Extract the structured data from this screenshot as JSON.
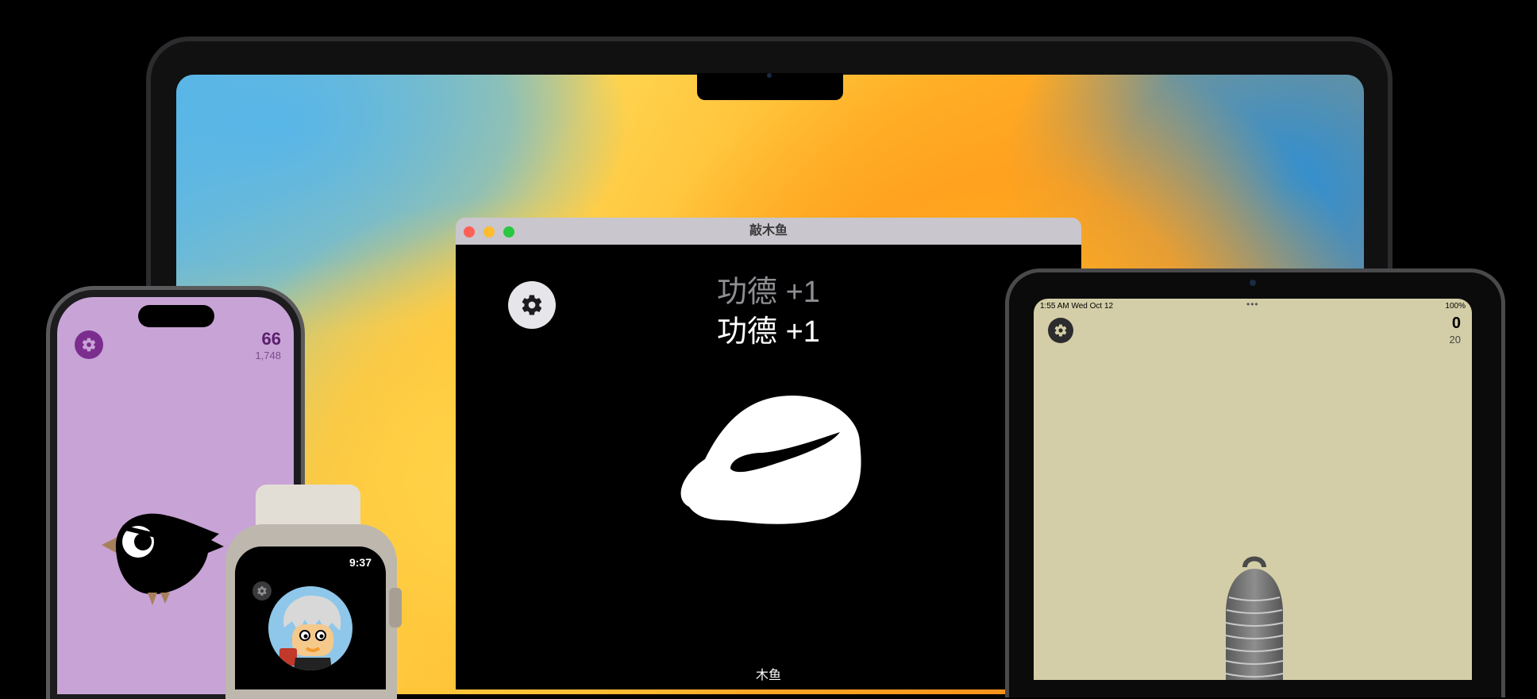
{
  "mac_window": {
    "title": "敲木鱼",
    "merit_faded": "功德 +1",
    "merit_main": "功德 +1",
    "bottom_label": "木鱼",
    "traffic_lights": {
      "close": "#ff5f57",
      "minimize": "#febc2e",
      "zoom": "#28c840"
    },
    "settings_icon": "gear-icon",
    "instrument_icon": "wooden-fish-icon"
  },
  "ipad": {
    "status_time": "1:55 AM  Wed Oct 12",
    "status_battery": "100%",
    "count": "0",
    "total": "20",
    "background": "#d4cea8",
    "settings_icon": "gear-icon",
    "instrument_icon": "bell-icon"
  },
  "iphone": {
    "count": "66",
    "total": "1,748",
    "background": "#c8a3d6",
    "settings_icon": "gear-icon",
    "instrument_icon": "crow-icon"
  },
  "watch": {
    "time": "9:37",
    "settings_icon": "gear-icon",
    "avatar_icon": "avatar-icon"
  }
}
